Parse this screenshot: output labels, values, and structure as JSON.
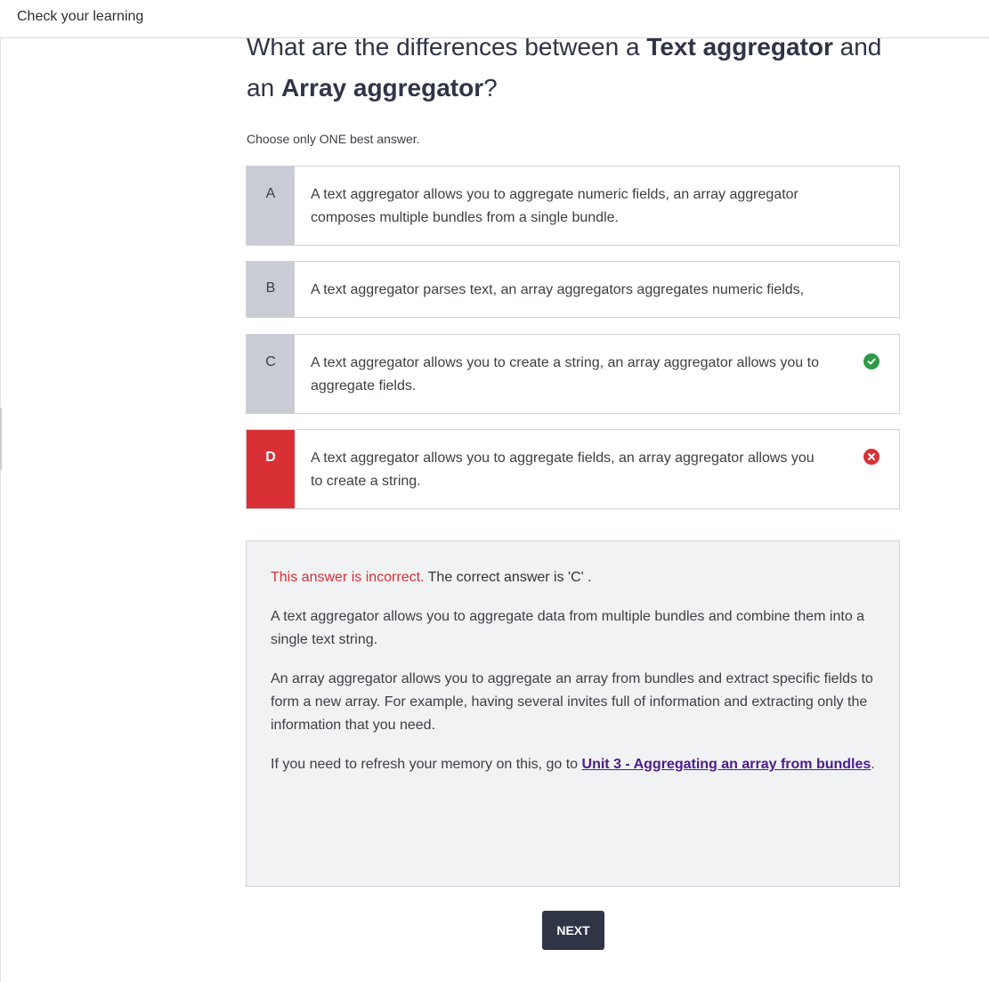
{
  "header": {
    "title": "Check your learning"
  },
  "question": {
    "prefix": "What are the differences between a ",
    "term1": "Text aggregator",
    "middle": " and an ",
    "term2": "Array aggregator",
    "suffix": "?",
    "instruction": "Choose only ONE best answer."
  },
  "options": [
    {
      "letter": "A",
      "text": "A text aggregator allows you to aggregate numeric fields, an array aggregator composes multiple bundles from a single bundle.",
      "state": "neutral"
    },
    {
      "letter": "B",
      "text": "A text aggregator parses text, an array aggregators aggregates numeric fields,",
      "state": "neutral"
    },
    {
      "letter": "C",
      "text": "A text aggregator allows you to create a string, an array aggregator allows you to aggregate fields.",
      "state": "correct",
      "icon": "check-circle-icon"
    },
    {
      "letter": "D",
      "text": "A text aggregator allows you to aggregate fields, an array aggregator allows you to create a string.",
      "state": "selected-incorrect",
      "icon": "x-circle-icon"
    }
  ],
  "feedback": {
    "incorrect_label": "This answer is incorrect.",
    "correct_label": " The correct answer is 'C' .",
    "para1": "A text aggregator allows you to aggregate data from multiple bundles and combine them into a single text string.",
    "para2": "An array aggregator allows you to aggregate an array from bundles and extract specific fields to form a new array. For example, having several invites full of information and extracting only the information that you need.",
    "para3_prefix": "If you need to refresh your memory on this, go to ",
    "para3_link": "Unit 3 - Aggregating an array from bundles",
    "para3_suffix": "."
  },
  "buttons": {
    "next": "NEXT"
  },
  "colors": {
    "incorrect": "#d93036",
    "correct": "#2e9a47",
    "button_bg": "#2f3447",
    "link": "#4a1c8e",
    "letter_bg": "#caccd5",
    "feedback_bg": "#f1f2f4"
  }
}
